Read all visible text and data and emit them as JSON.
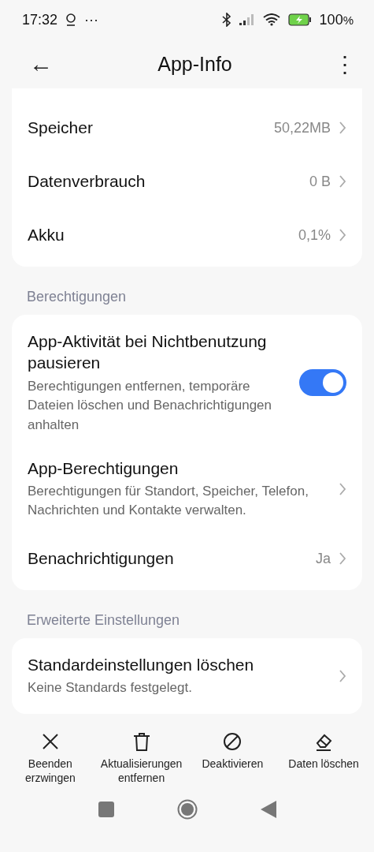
{
  "status_bar": {
    "time": "17:32",
    "overflow": "···",
    "battery": "100",
    "battery_unit": "%"
  },
  "header": {
    "back": "←",
    "title": "App-Info",
    "menu": "⋮"
  },
  "sections": [
    {
      "rows": [
        {
          "kind": "nav",
          "title": "Speicher",
          "value": "50,22MB"
        },
        {
          "kind": "nav",
          "title": "Datenverbrauch",
          "value": "0 B"
        },
        {
          "kind": "nav",
          "title": "Akku",
          "value": "0,1%"
        }
      ]
    },
    {
      "heading": "Berechtigungen",
      "rows": [
        {
          "kind": "toggle",
          "title": "App-Aktivität bei Nichtbenutzung pausieren",
          "subtitle": "Berechtigungen entfernen, temporäre Dateien löschen und Benachrichtigungen anhalten",
          "on": true
        },
        {
          "kind": "nav",
          "title": "App-Berechtigungen",
          "subtitle": "Berechtigungen für Standort, Speicher, Telefon, Nachrichten und Kontakte verwalten."
        },
        {
          "kind": "nav",
          "title": "Benachrichtigungen",
          "value": "Ja"
        }
      ]
    },
    {
      "heading": "Erweiterte Einstellungen",
      "rows": [
        {
          "kind": "nav",
          "title": "Standardeinstellungen löschen",
          "subtitle": "Keine Standards festgelegt."
        }
      ]
    }
  ],
  "actions": [
    {
      "kind": "close",
      "label": "Beenden erzwingen"
    },
    {
      "kind": "trash",
      "label": "Aktualisierungen entfernen"
    },
    {
      "kind": "block",
      "label": "Deaktivieren"
    },
    {
      "kind": "eraser",
      "label": "Daten löschen"
    }
  ]
}
